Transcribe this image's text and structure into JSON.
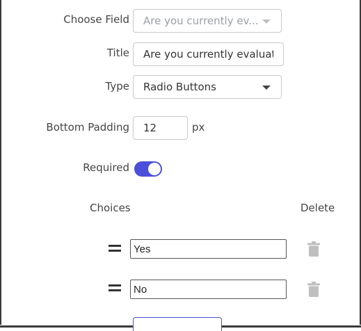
{
  "form": {
    "choose_field": {
      "label": "Choose Field",
      "value": "Are you currently ev..."
    },
    "title": {
      "label": "Title",
      "value": "Are you currently evaluat"
    },
    "type": {
      "label": "Type",
      "value": "Radio Buttons"
    },
    "bottom_padding": {
      "label": "Bottom Padding",
      "value": "12",
      "unit": "px"
    },
    "required": {
      "label": "Required",
      "on": true
    }
  },
  "choices": {
    "header_label": "Choices",
    "delete_label": "Delete",
    "items": [
      {
        "value": "Yes"
      },
      {
        "value": "No"
      }
    ]
  },
  "icons": {
    "drag": "drag-handle-icon",
    "delete": "trash-icon",
    "dropdown": "chevron-down-icon"
  },
  "colors": {
    "accent": "#4b4fd9",
    "icon_gray": "#bfbfbf",
    "border": "#c8c8c8"
  }
}
